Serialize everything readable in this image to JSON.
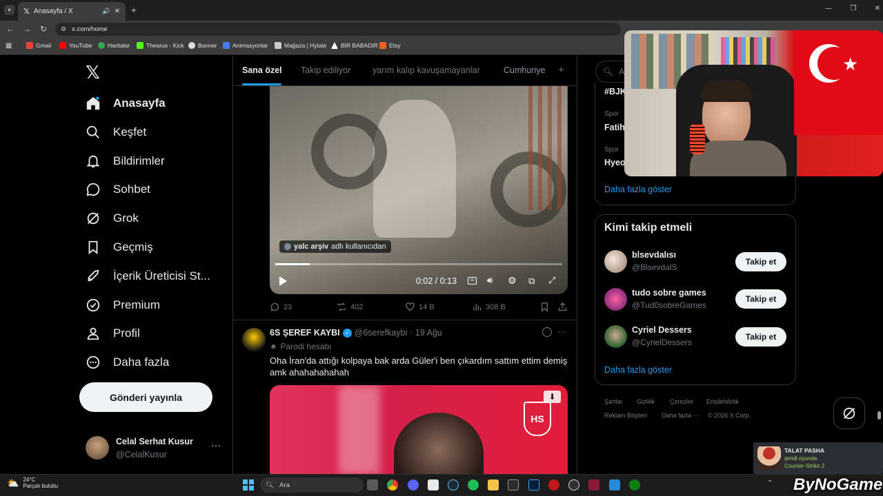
{
  "browser": {
    "tab_title": "Anasayfa / X",
    "url": "x.com/home",
    "bookmarks": [
      {
        "label": "Gmail",
        "color": "#ea4335"
      },
      {
        "label": "YouTube",
        "color": "#ff0000"
      },
      {
        "label": "Haritalar",
        "color": "#34a853"
      },
      {
        "label": "Thearus - Kick",
        "color": "#53fc18"
      },
      {
        "label": "Banner",
        "color": "#dddddd"
      },
      {
        "label": "Animasyonlar",
        "color": "#4b7bec"
      },
      {
        "label": "Mağaza | Hytale",
        "color": "#cccccc"
      },
      {
        "label": "BİR BABADIR",
        "color": "#ffffff"
      },
      {
        "label": "Etsy",
        "color": "#f1641e"
      }
    ]
  },
  "sidebar": {
    "items": [
      {
        "label": "Anasayfa",
        "icon": "home-icon"
      },
      {
        "label": "Keşfet",
        "icon": "search-icon"
      },
      {
        "label": "Bildirimler",
        "icon": "bell-icon"
      },
      {
        "label": "Sohbet",
        "icon": "chat-icon"
      },
      {
        "label": "Grok",
        "icon": "grok-icon"
      },
      {
        "label": "Geçmiş",
        "icon": "bookmark-icon"
      },
      {
        "label": "İçerik Üreticisi St...",
        "icon": "rocket-icon"
      },
      {
        "label": "Premium",
        "icon": "verified-icon"
      },
      {
        "label": "Profil",
        "icon": "person-icon"
      },
      {
        "label": "Daha fazla",
        "icon": "more-circle-icon"
      }
    ],
    "post_button": "Gönderi yayınla",
    "account": {
      "name": "Celal Serhat Kusur",
      "handle": "@CelalKusur"
    }
  },
  "feed": {
    "tabs": [
      "Sana özel",
      "Takip ediliyor",
      "yarım kalıp kavuşamayanlar",
      "Cumhuriye"
    ],
    "video": {
      "source_user": "yalc arşiv",
      "source_suffix": "adlı kullanıcıdan",
      "time": "0:02 / 0:13",
      "progress": 0.12
    },
    "tweet1_actions": {
      "replies": "23",
      "reposts": "402",
      "likes": "14 B",
      "views": "308 B"
    },
    "tweet2": {
      "name": "6S ŞEREF KAYBI",
      "handle": "@6serefkaybi",
      "date": "· 19 Ağu",
      "label": "Parodi hesabı",
      "text": "Oha İran'da attığı kolpaya bak arda Güler'i ben çıkardım sattım ettim demiş amk ahahahahahah"
    }
  },
  "right": {
    "search_placeholder": "Ara",
    "trends": [
      {
        "text": "#BJK",
        "context": ""
      },
      {
        "context": "Spor",
        "text": "Fatih"
      },
      {
        "context": "Spor",
        "text": "Hyeo"
      }
    ],
    "show_more": "Daha fazla göster",
    "who_to_follow": {
      "title": "Kimi takip etmeli",
      "users": [
        {
          "name": "blsevdalısı",
          "handle": "@BlsevdalS",
          "button": "Takip et",
          "color": "#c9a27e"
        },
        {
          "name": "tudo sobre games",
          "handle": "@Tud0sobreGames",
          "button": "Takip et",
          "color": "#8e2a8a"
        },
        {
          "name": "Cyriel Dessers",
          "handle": "@CyrielDessers",
          "button": "Takip et",
          "color": "#2e7d32"
        }
      ],
      "show_more": "Daha fazla göster"
    },
    "footer": [
      "Şartlar",
      "Gizlilik",
      "Çerezler",
      "Erişilebilirlik",
      "Reklam Bilgileri",
      "Daha fazla ···",
      "© 2026 X Corp."
    ]
  },
  "overlay": {
    "game_title": "TALAT PASHA",
    "game_status": "şimdi oyunda",
    "game_name": "Counter-Strike 2",
    "watermark": "ByNoGame"
  },
  "taskbar": {
    "weather_temp": "24°C",
    "weather_text": "Parçalı bulutlu",
    "search": "Ara"
  }
}
